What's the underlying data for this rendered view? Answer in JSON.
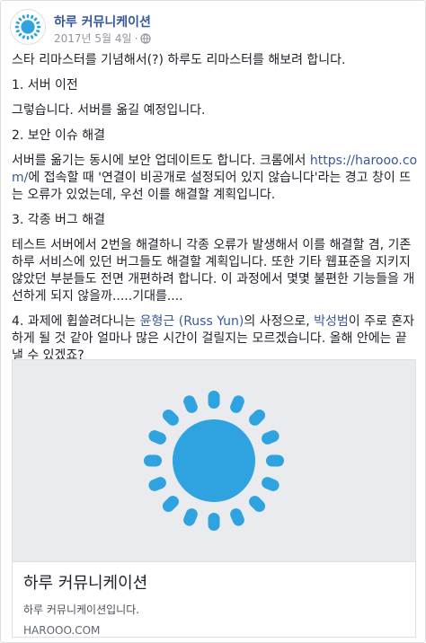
{
  "header": {
    "page_name": "하루 커뮤니케이션",
    "date": "2017년 5월 4일",
    "separator": "·"
  },
  "post": {
    "intro": "스타 리마스터를 기념해서(?) 하루도 리마스터를 해보려 합니다.",
    "s1_title": "1. 서버 이전",
    "s1_body": "그렇습니다. 서버를 옮길 예정입니다.",
    "s2_title": "2. 보안 이슈 해결",
    "s2_body_a": "서버를 옮기는 동시에 보안 업데이트도 합니다. 크롬에서 ",
    "s2_link": "https://harooo.com/",
    "s2_body_b": "에 접속할 때 '연결이 비공개로 설정되어 있지 않습니다'라는 경고 창이 뜨는 오류가 있었는데, 우선 이를 해결할 계획입니다.",
    "s3_title": "3. 각종 버그 해결",
    "s3_body": "테스트 서버에서 2번을 해결하니 각종 오류가 발생해서 이를 해결할 겸, 기존 하루 서비스에 있던 버그들도 해결할 계획입니다. 또한 기타 웹표준을 지키지 않았던 부분들도 전면 개편하려 합니다. 이 과정에서 몇몇 불편한 기능들을 개선하게 되지 않을까.....기대를....",
    "s4_a": "4. 과제에 휩쓸려다니는 ",
    "s4_name1": "윤형근 (Russ Yun)",
    "s4_b": "의 사정으로, ",
    "s4_name2": "박성범",
    "s4_c": "이 주로 혼자 하게 될 것 같아 얼마나 많은 시간이 걸릴지는 모르겠습니다. 올해 안에는 끝낼 수 있겠죠?"
  },
  "link_card": {
    "title": "하루 커뮤니케이션",
    "description": "하루 커뮤니케이션입니다.",
    "domain": "HAROOO.COM"
  },
  "colors": {
    "brand_blue": "#2ea3e0",
    "link": "#385898"
  },
  "icons": {
    "avatar": "sun-logo-icon",
    "privacy": "globe-icon",
    "preview": "sun-logo-icon"
  }
}
